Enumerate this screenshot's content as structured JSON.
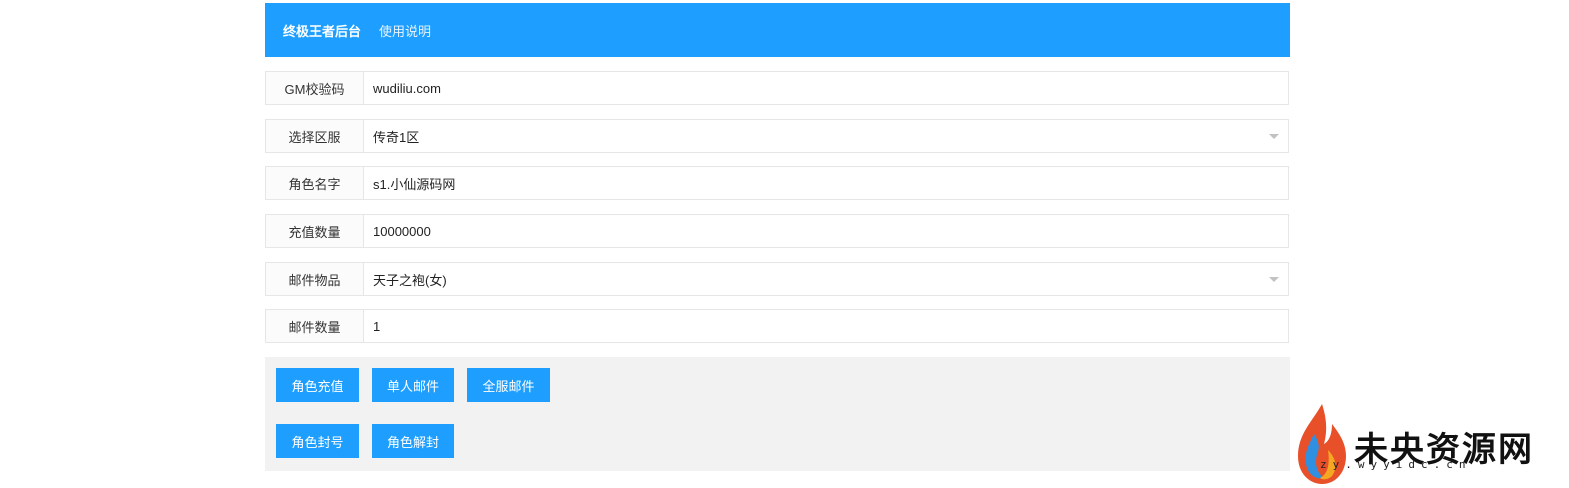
{
  "header": {
    "brand": "终极王者后台",
    "help_link": "使用说明"
  },
  "form": {
    "rows": [
      {
        "label": "GM校验码",
        "value": "wudiliu.com",
        "kind": "input"
      },
      {
        "label": "选择区服",
        "value": "传奇1区",
        "kind": "select"
      },
      {
        "label": "角色名字",
        "value": "s1.小仙源码网",
        "kind": "input"
      },
      {
        "label": "充值数量",
        "value": "10000000",
        "kind": "input"
      },
      {
        "label": "邮件物品",
        "value": "天子之袍(女)",
        "kind": "select"
      },
      {
        "label": "邮件数量",
        "value": "1",
        "kind": "input"
      }
    ]
  },
  "actions": {
    "recharge": "角色充值",
    "single_mail": "单人邮件",
    "server_mail": "全服邮件",
    "ban": "角色封号",
    "unban": "角色解封"
  },
  "watermark": {
    "title": "未央资源网",
    "url": "zy.wyyidc.cn"
  },
  "colors": {
    "primary": "#1e9fff",
    "action_bg": "#f2f2f2",
    "border": "#e6e6e6"
  }
}
